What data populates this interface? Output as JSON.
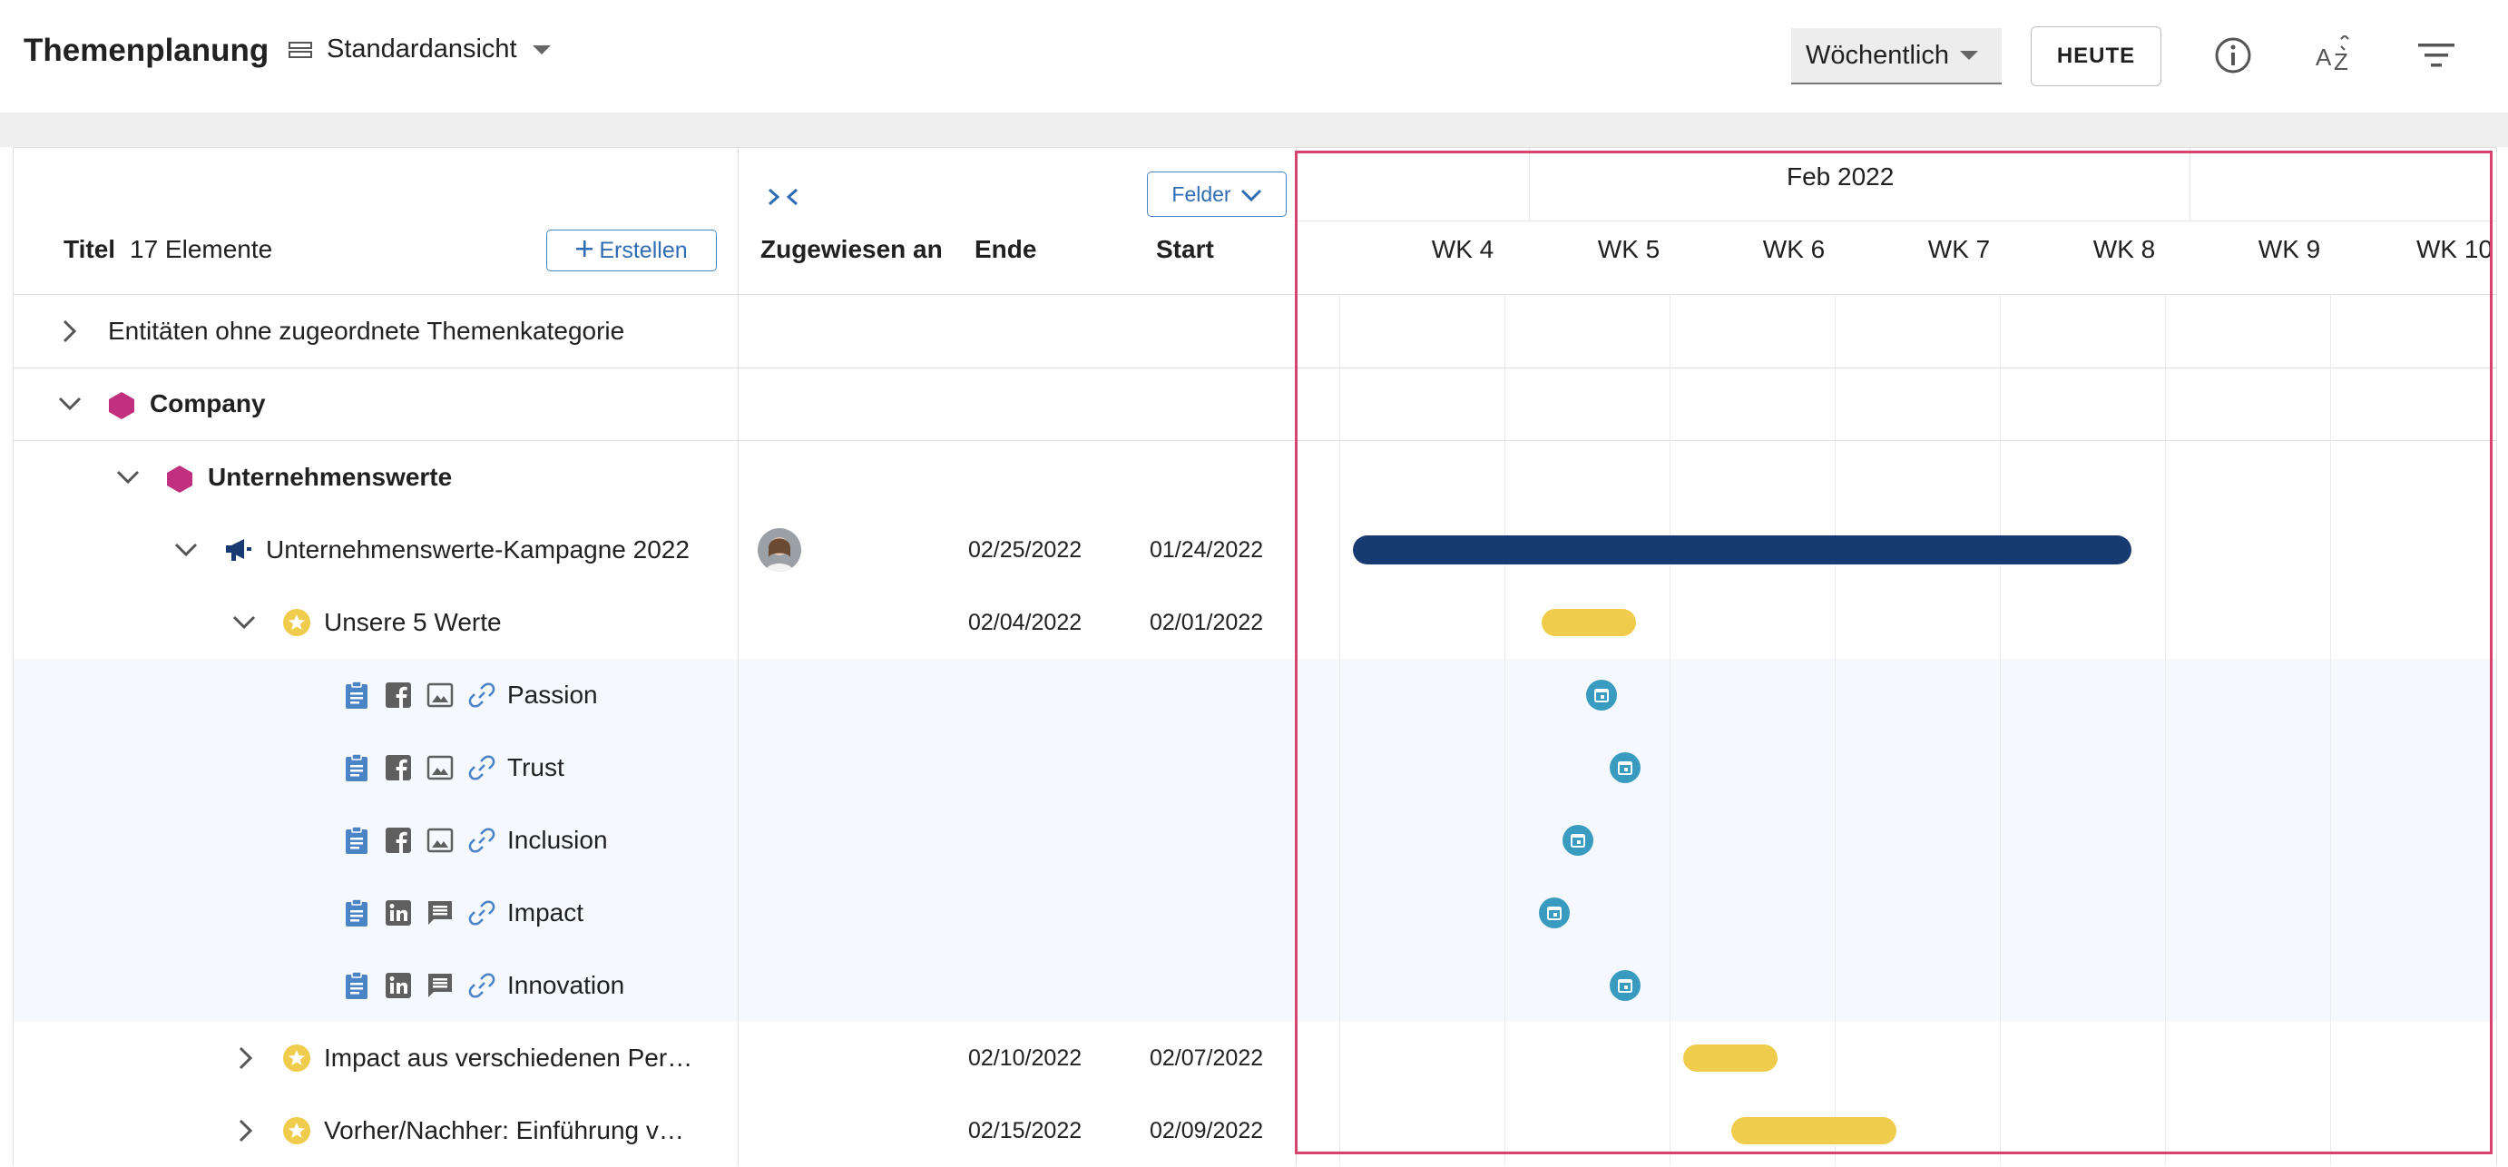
{
  "header": {
    "app_title": "Themenplanung",
    "view_label": "Standardansicht",
    "period_label": "Wöchentlich",
    "today_label": "HEUTE"
  },
  "table": {
    "title_label": "Titel",
    "count_label": "17 Elemente",
    "create_label": "Erstellen",
    "fields_label": "Felder",
    "col_assigned": "Zugewiesen an",
    "col_end": "Ende",
    "col_start": "Start"
  },
  "timeline": {
    "month": "Feb 2022",
    "weeks": [
      "WK 4",
      "WK 5",
      "WK 6",
      "WK 7",
      "WK 8",
      "WK 9",
      "WK 10"
    ]
  },
  "rows": [
    {
      "label": "Entitäten ohne zugeordnete Themenkategorie"
    },
    {
      "label": "Company"
    },
    {
      "label": "Unternehmenswerte"
    },
    {
      "label": "Unternehmenswerte-Kampagne 2022",
      "end": "02/25/2022",
      "start": "01/24/2022"
    },
    {
      "label": "Unsere 5 Werte",
      "end": "02/04/2022",
      "start": "02/01/2022"
    },
    {
      "label": "Passion"
    },
    {
      "label": "Trust"
    },
    {
      "label": "Inclusion"
    },
    {
      "label": "Impact"
    },
    {
      "label": "Innovation"
    },
    {
      "label": "Impact aus verschiedenen Per…",
      "end": "02/10/2022",
      "start": "02/07/2022"
    },
    {
      "label": "Vorher/Nachher: Einführung v…",
      "end": "02/15/2022",
      "start": "02/09/2022"
    }
  ],
  "colors": {
    "accent": "#2e6db4",
    "campaign_bar": "#183a72",
    "story_bar": "#f0cc4c",
    "item_dot": "#3a9bc1",
    "category_hex": "#c1307e",
    "highlight_frame": "#d6446e"
  }
}
